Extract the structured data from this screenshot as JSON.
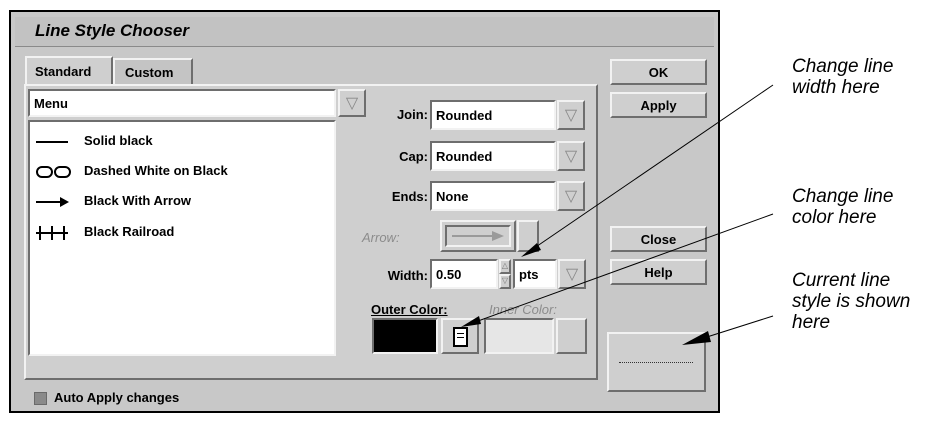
{
  "window": {
    "title": "Line Style Chooser"
  },
  "tabs": [
    {
      "label": "Standard"
    },
    {
      "label": "Custom"
    }
  ],
  "menu": {
    "value": "Menu"
  },
  "styles": [
    {
      "label": "Solid black",
      "icon": "solid-line-icon"
    },
    {
      "label": "Dashed White on Black",
      "icon": "dashed-line-icon"
    },
    {
      "label": "Black With Arrow",
      "icon": "arrow-line-icon"
    },
    {
      "label": "Black Railroad",
      "icon": "railroad-line-icon"
    }
  ],
  "join": {
    "label": "Join:",
    "value": "Rounded"
  },
  "cap": {
    "label": "Cap:",
    "value": "Rounded"
  },
  "ends": {
    "label": "Ends:",
    "value": "None"
  },
  "arrow": {
    "label": "Arrow:"
  },
  "width": {
    "label": "Width:",
    "value": "0.50",
    "unit": "pts"
  },
  "outer_color": {
    "label": "Outer Color:",
    "value": "#000000"
  },
  "inner_color": {
    "label": "Inner Color:"
  },
  "buttons": {
    "ok": "OK",
    "apply": "Apply",
    "close": "Close",
    "help": "Help"
  },
  "auto_apply": {
    "label": "Auto Apply changes",
    "checked": false
  },
  "annotations": {
    "width": "Change line width here",
    "color": "Change line color here",
    "style": "Current line style is shown here"
  },
  "colors": {
    "panel": "#c8c8c8",
    "title_bar": "#bdbdbd",
    "field": "#ffffff"
  }
}
